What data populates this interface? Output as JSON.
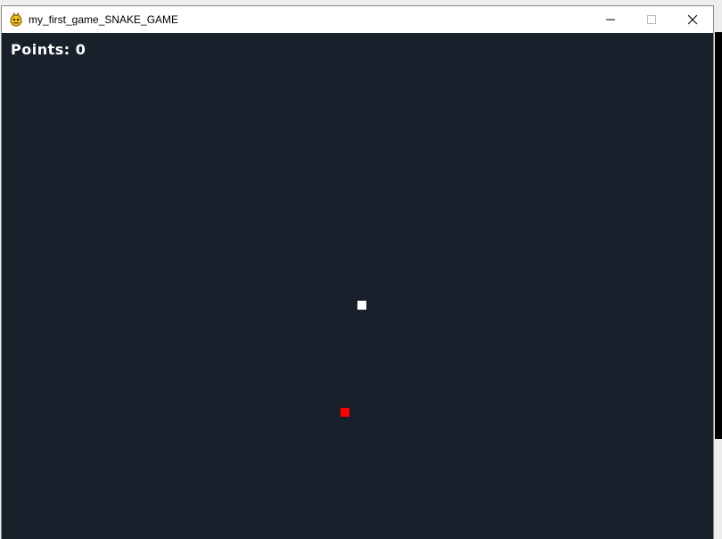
{
  "window": {
    "title": "my_first_game_SNAKE_GAME",
    "app_icon": "pygame-snake-icon",
    "controls": {
      "minimize_icon": "minimize-icon",
      "maximize_icon": "maximize-icon",
      "close_icon": "close-icon"
    }
  },
  "game": {
    "score_text": "Points: 0",
    "background_color": "#18202b",
    "snake_color": "#ffffff",
    "food_color": "#ff0000"
  }
}
